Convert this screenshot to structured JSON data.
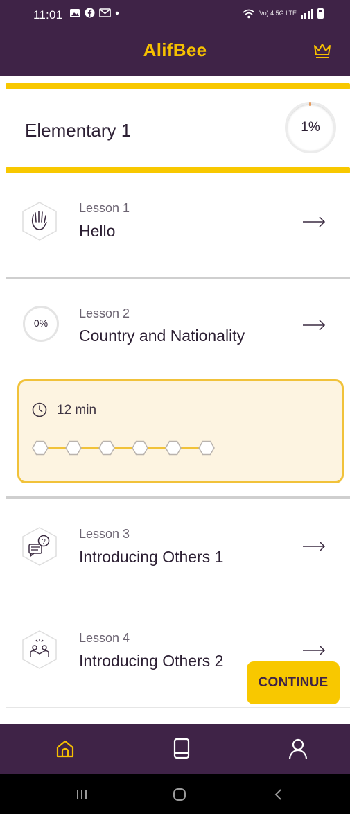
{
  "status_bar": {
    "time": "11:01",
    "network_label": "Vo) 4.5G LTE"
  },
  "header": {
    "app_title": "AlifBee",
    "brand_color": "#f6c000",
    "background_color": "#3f2347",
    "crown_icon": "crown-icon"
  },
  "level": {
    "title": "Elementary 1",
    "progress_text": "1%",
    "progress": 0.01
  },
  "lessons": [
    {
      "number_label": "Lesson 1",
      "title": "Hello",
      "icon": "hand-icon"
    },
    {
      "number_label": "Lesson 2",
      "title": "Country and Nationality",
      "progress_text": "0%"
    },
    {
      "number_label": "Lesson 3",
      "title": "Introducing Others 1",
      "icon": "speech-question-icon"
    },
    {
      "number_label": "Lesson 4",
      "title": "Introducing Others 2",
      "icon": "people-icon"
    }
  ],
  "expanded_lesson": {
    "duration": "12 min",
    "step_count": 6,
    "steps_completed": 0
  },
  "continue_button": {
    "label": "CONTINUE"
  },
  "bottom_nav": {
    "items": [
      "home",
      "book",
      "profile"
    ],
    "active": "home",
    "active_color": "#f6c000"
  },
  "system_nav": {
    "items": [
      "recent-apps",
      "home",
      "back"
    ]
  }
}
